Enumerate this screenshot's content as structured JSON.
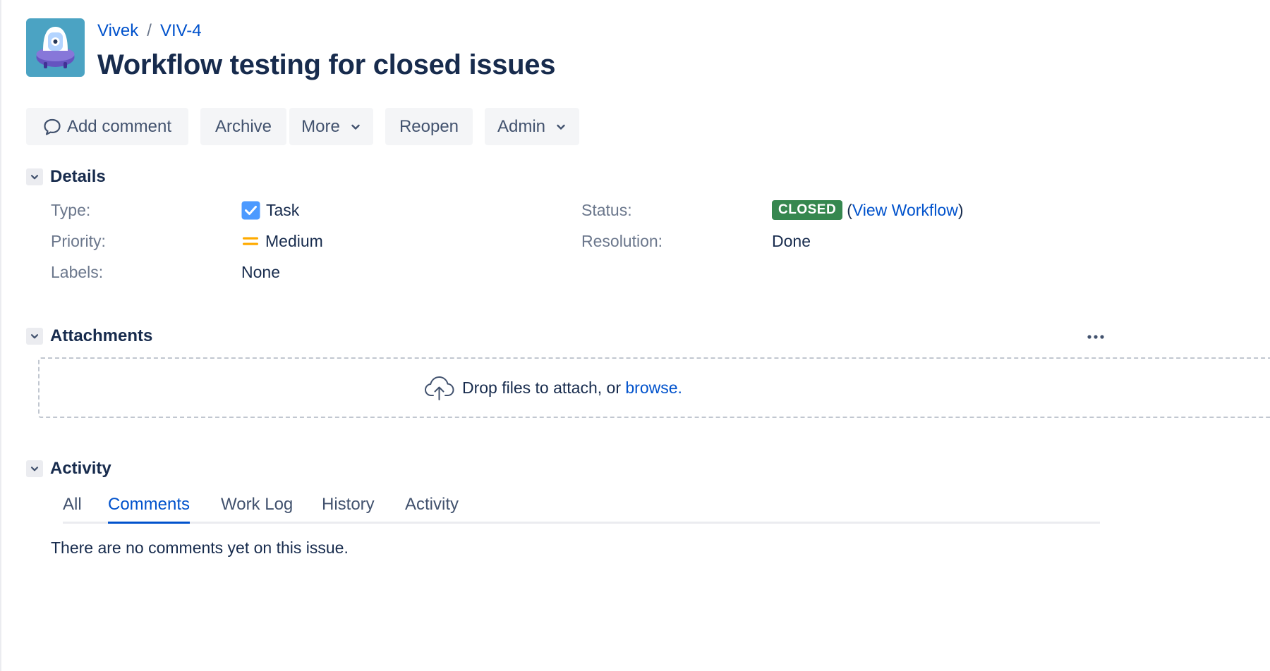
{
  "breadcrumb": {
    "project": "Vivek",
    "separator": "/",
    "issue_key": "VIV-4"
  },
  "issue": {
    "title": "Workflow testing for closed issues"
  },
  "toolbar": {
    "add_comment": "Add comment",
    "archive": "Archive",
    "more": "More",
    "reopen": "Reopen",
    "admin": "Admin"
  },
  "details": {
    "heading": "Details",
    "type_label": "Type:",
    "type_value": "Task",
    "priority_label": "Priority:",
    "priority_value": "Medium",
    "labels_label": "Labels:",
    "labels_value": "None",
    "status_label": "Status:",
    "status_value": "CLOSED",
    "view_workflow_open": "(",
    "view_workflow": "View Workflow",
    "view_workflow_close": ")",
    "resolution_label": "Resolution:",
    "resolution_value": "Done"
  },
  "attachments": {
    "heading": "Attachments",
    "drop_text": "Drop files to attach, or ",
    "browse_link": "browse."
  },
  "activity": {
    "heading": "Activity",
    "tabs": [
      "All",
      "Comments",
      "Work Log",
      "History",
      "Activity"
    ],
    "active_tab": "Comments",
    "empty_message": "There are no comments yet on this issue."
  },
  "colors": {
    "link": "#0052cc",
    "closed_lozenge": "#36874f",
    "task_icon": "#4c9aff",
    "medium_priority": "#ffab00",
    "avatar_bg": "#4ba3c3"
  },
  "icons": {
    "avatar": "project-robot-avatar",
    "add_comment": "speech-bubble-icon",
    "more": "chevron-down-icon",
    "admin": "chevron-down-icon",
    "type": "task-checkbox-icon",
    "priority": "medium-priority-icon",
    "attachments_menu": "more-dots-icon",
    "drop": "cloud-upload-icon",
    "section_toggle": "chevron-down-icon"
  }
}
